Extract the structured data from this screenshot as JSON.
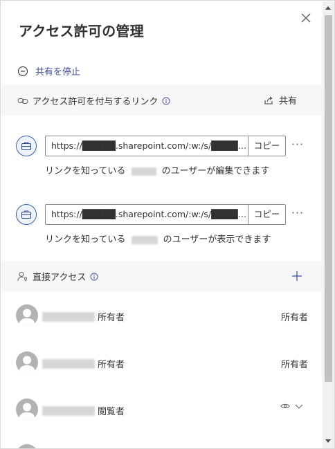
{
  "dialog": {
    "title": "アクセス許可の管理",
    "close_icon": "close-icon"
  },
  "stop_sharing": {
    "label": "共有を停止",
    "icon": "minus-circle-icon"
  },
  "links_section": {
    "heading": "アクセス許可を付与するリンク",
    "share_label": "共有",
    "links": [
      {
        "url": "https://█████.sharepoint.com/:w:/s/█████...",
        "copy_label": "コピー",
        "more": "···",
        "desc_prefix": "リンクを知っている",
        "desc_suffix": "のユーザーが編集できます"
      },
      {
        "url": "https://█████.sharepoint.com/:w:/s/█████...",
        "copy_label": "コピー",
        "more": "···",
        "desc_prefix": "リンクを知っている",
        "desc_suffix": "のユーザーが表示できます"
      }
    ]
  },
  "direct_access": {
    "heading": "直接アクセス",
    "people": [
      {
        "name_suffix": "所有者",
        "role": "所有者"
      },
      {
        "name_suffix": "所有者",
        "role": "所有者"
      },
      {
        "name_suffix": "閲覧者",
        "role": ""
      }
    ]
  },
  "colors": {
    "accent": "#3d4a99",
    "band": "#f7f7f7",
    "border": "#8a8886"
  }
}
